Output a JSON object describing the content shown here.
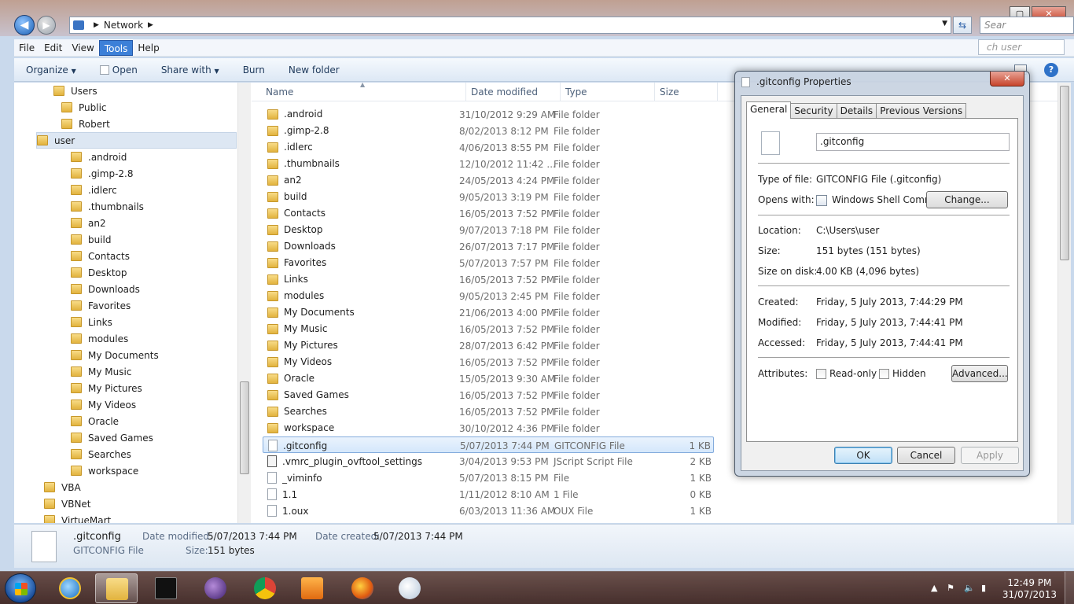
{
  "window": {
    "address": [
      "Network"
    ],
    "search_placeholder": "Sear",
    "menu": [
      "File",
      "Edit",
      "View",
      "Tools",
      "Help"
    ],
    "menu_active": "Tools",
    "search_user_placeholder": "ch user",
    "toolbar": [
      "Organize",
      "Open",
      "Share with",
      "Burn",
      "New folder"
    ],
    "controls": {
      "minimize": "—",
      "maximize": "▢",
      "close": "✕"
    }
  },
  "navpane": [
    {
      "label": "Users",
      "indent": 1
    },
    {
      "label": "Public",
      "indent": 2
    },
    {
      "label": "Robert",
      "indent": 2
    },
    {
      "label": "user",
      "indent": 2,
      "selected": true
    },
    {
      "label": ".android",
      "indent": 3
    },
    {
      "label": ".gimp-2.8",
      "indent": 3
    },
    {
      "label": ".idlerc",
      "indent": 3
    },
    {
      "label": ".thumbnails",
      "indent": 3
    },
    {
      "label": "an2",
      "indent": 3
    },
    {
      "label": "build",
      "indent": 3
    },
    {
      "label": "Contacts",
      "indent": 3
    },
    {
      "label": "Desktop",
      "indent": 3
    },
    {
      "label": "Downloads",
      "indent": 3
    },
    {
      "label": "Favorites",
      "indent": 3
    },
    {
      "label": "Links",
      "indent": 3
    },
    {
      "label": "modules",
      "indent": 3
    },
    {
      "label": "My Documents",
      "indent": 3
    },
    {
      "label": "My Music",
      "indent": 3
    },
    {
      "label": "My Pictures",
      "indent": 3
    },
    {
      "label": "My Videos",
      "indent": 3
    },
    {
      "label": "Oracle",
      "indent": 3
    },
    {
      "label": "Saved Games",
      "indent": 3
    },
    {
      "label": "Searches",
      "indent": 3
    },
    {
      "label": "workspace",
      "indent": 3
    },
    {
      "label": "VBA",
      "indent": 0
    },
    {
      "label": "VBNet",
      "indent": 0
    },
    {
      "label": "VirtueMart",
      "indent": 0
    }
  ],
  "columns": {
    "name": "Name",
    "date": "Date modified",
    "type": "Type",
    "size": "Size"
  },
  "files": [
    {
      "name": ".android",
      "date": "31/10/2012 9:29 AM",
      "type": "File folder",
      "size": "",
      "kind": "folder"
    },
    {
      "name": ".gimp-2.8",
      "date": "8/02/2013 8:12 PM",
      "type": "File folder",
      "size": "",
      "kind": "folder"
    },
    {
      "name": ".idlerc",
      "date": "4/06/2013 8:55 PM",
      "type": "File folder",
      "size": "",
      "kind": "folder"
    },
    {
      "name": ".thumbnails",
      "date": "12/10/2012 11:42 ...",
      "type": "File folder",
      "size": "",
      "kind": "folder"
    },
    {
      "name": "an2",
      "date": "24/05/2013 4:24 PM",
      "type": "File folder",
      "size": "",
      "kind": "folder"
    },
    {
      "name": "build",
      "date": "9/05/2013 3:19 PM",
      "type": "File folder",
      "size": "",
      "kind": "folder"
    },
    {
      "name": "Contacts",
      "date": "16/05/2013 7:52 PM",
      "type": "File folder",
      "size": "",
      "kind": "folder"
    },
    {
      "name": "Desktop",
      "date": "9/07/2013 7:18 PM",
      "type": "File folder",
      "size": "",
      "kind": "folder"
    },
    {
      "name": "Downloads",
      "date": "26/07/2013 7:17 PM",
      "type": "File folder",
      "size": "",
      "kind": "folder"
    },
    {
      "name": "Favorites",
      "date": "5/07/2013 7:57 PM",
      "type": "File folder",
      "size": "",
      "kind": "folder"
    },
    {
      "name": "Links",
      "date": "16/05/2013 7:52 PM",
      "type": "File folder",
      "size": "",
      "kind": "folder"
    },
    {
      "name": "modules",
      "date": "9/05/2013 2:45 PM",
      "type": "File folder",
      "size": "",
      "kind": "folder"
    },
    {
      "name": "My Documents",
      "date": "21/06/2013 4:00 PM",
      "type": "File folder",
      "size": "",
      "kind": "folder"
    },
    {
      "name": "My Music",
      "date": "16/05/2013 7:52 PM",
      "type": "File folder",
      "size": "",
      "kind": "folder"
    },
    {
      "name": "My Pictures",
      "date": "28/07/2013 6:42 PM",
      "type": "File folder",
      "size": "",
      "kind": "folder"
    },
    {
      "name": "My Videos",
      "date": "16/05/2013 7:52 PM",
      "type": "File folder",
      "size": "",
      "kind": "folder"
    },
    {
      "name": "Oracle",
      "date": "15/05/2013 9:30 AM",
      "type": "File folder",
      "size": "",
      "kind": "folder"
    },
    {
      "name": "Saved Games",
      "date": "16/05/2013 7:52 PM",
      "type": "File folder",
      "size": "",
      "kind": "folder"
    },
    {
      "name": "Searches",
      "date": "16/05/2013 7:52 PM",
      "type": "File folder",
      "size": "",
      "kind": "folder"
    },
    {
      "name": "workspace",
      "date": "30/10/2012 4:36 PM",
      "type": "File folder",
      "size": "",
      "kind": "folder"
    },
    {
      "name": ".gitconfig",
      "date": "5/07/2013 7:44 PM",
      "type": "GITCONFIG File",
      "size": "1 KB",
      "kind": "file",
      "selected": true
    },
    {
      "name": ".vmrc_plugin_ovftool_settings",
      "date": "3/04/2013 9:53 PM",
      "type": "JScript Script File",
      "size": "2 KB",
      "kind": "js"
    },
    {
      "name": "_viminfo",
      "date": "5/07/2013 8:15 PM",
      "type": "File",
      "size": "1 KB",
      "kind": "file"
    },
    {
      "name": "1.1",
      "date": "1/11/2012 8:10 AM",
      "type": "1 File",
      "size": "0 KB",
      "kind": "file"
    },
    {
      "name": "1.oux",
      "date": "6/03/2013 11:36 AM",
      "type": "OUX File",
      "size": "1 KB",
      "kind": "file"
    }
  ],
  "details": {
    "name": ".gitconfig",
    "type": "GITCONFIG File",
    "date_modified_label": "Date modified:",
    "date_modified": "5/07/2013 7:44 PM",
    "date_created_label": "Date created:",
    "date_created": "5/07/2013 7:44 PM",
    "size_label": "Size:",
    "size": "151 bytes"
  },
  "dialog": {
    "title": ".gitconfig Properties",
    "tabs": [
      "General",
      "Security",
      "Details",
      "Previous Versions"
    ],
    "filename": ".gitconfig",
    "type_label": "Type of file:",
    "type_value": "GITCONFIG File (.gitconfig)",
    "opens_label": "Opens with:",
    "opens_value": "Windows Shell Commor",
    "change_button": "Change...",
    "location_label": "Location:",
    "location_value": "C:\\Users\\user",
    "size_label": "Size:",
    "size_value": "151 bytes (151 bytes)",
    "size_disk_label": "Size on disk:",
    "size_disk_value": "4.00 KB (4,096 bytes)",
    "created_label": "Created:",
    "created_value": "Friday, 5 July 2013, 7:44:29 PM",
    "modified_label": "Modified:",
    "modified_value": "Friday, 5 July 2013, 7:44:41 PM",
    "accessed_label": "Accessed:",
    "accessed_value": "Friday, 5 July 2013, 7:44:41 PM",
    "attributes_label": "Attributes:",
    "readonly_label": "Read-only",
    "hidden_label": "Hidden",
    "advanced_button": "Advanced...",
    "ok_button": "OK",
    "cancel_button": "Cancel",
    "apply_button": "Apply"
  },
  "taskbar": {
    "time": "12:49 PM",
    "date": "31/07/2013",
    "apps": [
      "internet-explorer",
      "windows-explorer",
      "command-prompt",
      "eclipse",
      "chrome",
      "media-player",
      "firefox",
      "paint"
    ]
  }
}
